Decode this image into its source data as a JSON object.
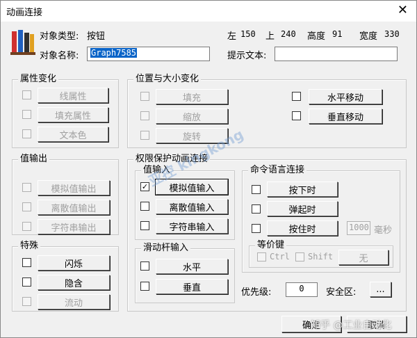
{
  "window": {
    "title": "动画连接",
    "close_glyph": "✕"
  },
  "header": {
    "type_label": "对象类型:",
    "type_value": "按钮",
    "left_label": "左",
    "left_value": "150",
    "top_label": "上",
    "top_value": "240",
    "height_label": "高度",
    "height_value": "91",
    "width_label": "宽度",
    "width_value": "330",
    "name_label": "对象名称:",
    "name_value": "Graph7585",
    "hint_label": "提示文本:",
    "hint_value": ""
  },
  "attr_group": {
    "title": "属性变化",
    "buttons": [
      "线属性",
      "填充属性",
      "文本色"
    ]
  },
  "pos_group": {
    "title": "位置与大小变化",
    "left_buttons": [
      "填充",
      "缩放",
      "旋转"
    ],
    "right_buttons": [
      "水平移动",
      "垂直移动"
    ]
  },
  "value_out_group": {
    "title": "值输出",
    "buttons": [
      "模拟值输出",
      "离散值输出",
      "字符串输出"
    ]
  },
  "special_group": {
    "title": "特殊",
    "buttons": [
      "闪烁",
      "隐含",
      "流动"
    ]
  },
  "perm_group": {
    "title": "权限保护动画连接",
    "value_in": {
      "title": "值输入",
      "buttons": [
        "模拟值输入",
        "离散值输入",
        "字符串输入"
      ],
      "checked": [
        true,
        false,
        false
      ],
      "check_glyph": "✓"
    },
    "slider_in": {
      "title": "滑动杆输入",
      "buttons": [
        "水平",
        "垂直"
      ]
    },
    "cmd": {
      "title": "命令语言连接",
      "buttons": [
        "按下时",
        "弹起时",
        "按住时"
      ],
      "interval_value": "1000",
      "interval_unit": "毫秒"
    },
    "equiv": {
      "title": "等价键",
      "ctrl_label": "Ctrl",
      "shift_label": "Shift",
      "key_value": "无"
    },
    "priority_label": "优先级:",
    "priority_value": "0",
    "security_label": "安全区:",
    "security_button": "..."
  },
  "footer": {
    "ok_label": "确定",
    "cancel_label": "取消"
  },
  "watermark": {
    "text": "亚控 kingkong",
    "overlay": "知乎 @工业自动化"
  },
  "colors": {
    "selection": "#0a64c8",
    "disabled_text": "#a0a0a0",
    "dialog_bg": "#f0f0f0"
  }
}
